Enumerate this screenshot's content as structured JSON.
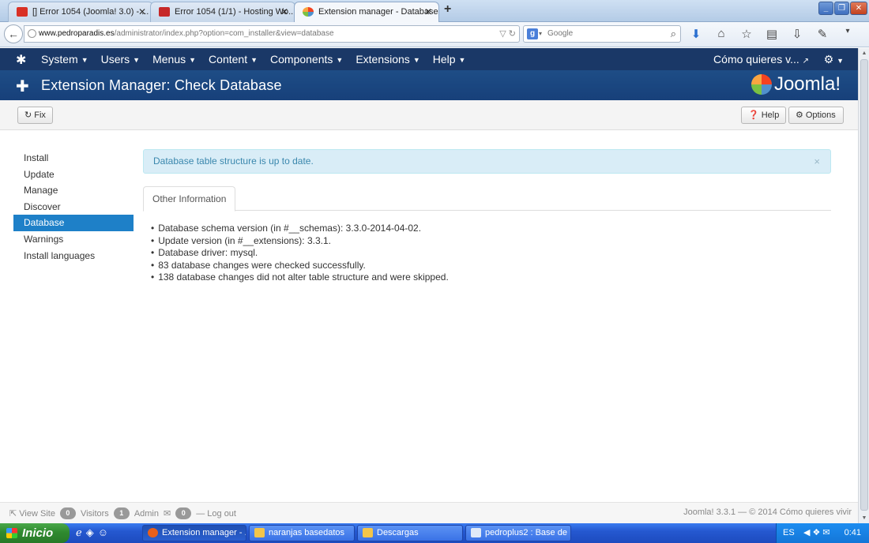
{
  "browser": {
    "tabs": [
      {
        "title": "[] Error 1054 (Joomla! 3.0) - ...",
        "favicon_color": "#d93025",
        "active": false
      },
      {
        "title": "Error 1054 (1/1) - Hosting Wo...",
        "favicon_color": "#c62828",
        "active": false
      },
      {
        "title": "Extension manager - Database",
        "favicon_color": "#f44321",
        "active": true
      }
    ],
    "new_tab_symbol": "+",
    "close_symbol": "✕",
    "url_host": "www.pedroparadis.es",
    "url_path": "/administrator/index.php?option=com_installer&view=database",
    "search_placeholder": "Google",
    "search_engine_letter": "g"
  },
  "joomla_nav": {
    "menus": [
      "System",
      "Users",
      "Menus",
      "Content",
      "Components",
      "Extensions",
      "Help"
    ],
    "site_link": "Cómo quieres v..."
  },
  "subhead": {
    "title": "Extension Manager: Check Database",
    "brand": "Joomla!"
  },
  "toolbar": {
    "fix_label": "Fix",
    "help_label": "Help",
    "options_label": "Options"
  },
  "sidebar": {
    "items": [
      "Install",
      "Update",
      "Manage",
      "Discover",
      "Database",
      "Warnings",
      "Install languages"
    ],
    "active_index": 4
  },
  "alert": {
    "message": "Database table structure is up to date.",
    "close_symbol": "×"
  },
  "tab_label": "Other Information",
  "info": [
    "Database schema version (in #__schemas): 3.3.0-2014-04-02.",
    "Update version (in #__extensions): 3.3.1.",
    "Database driver: mysql.",
    "83 database changes were checked successfully.",
    "138 database changes did not alter table structure and were skipped."
  ],
  "status": {
    "view_site": "View Site",
    "visitors_count": "0",
    "visitors_label": "Visitors",
    "admin_count": "1",
    "admin_label": "Admin",
    "messages_count": "0",
    "logout": "Log out",
    "footer": "Joomla! 3.3.1 — © 2014 Cómo quieres vivir"
  },
  "taskbar": {
    "start_label": "Inicio",
    "tasks": [
      {
        "label": "Extension manager - ...",
        "icon_color": "#e8601c",
        "active": true
      },
      {
        "label": "naranjas basedatos",
        "icon_color": "#f3c54a",
        "active": false
      },
      {
        "label": "Descargas",
        "icon_color": "#f3c54a",
        "active": false
      },
      {
        "label": "pedroplus2 : Base de ...",
        "icon_color": "#dfe9f8",
        "active": false
      }
    ],
    "lang": "ES",
    "clock": "0:41"
  },
  "colors": {
    "joomla_nav_bg": "#1a3867",
    "subhead_bg": "#1e4d86",
    "sidebar_active": "#1e80c8",
    "alert_bg": "#d9edf7",
    "alert_text": "#3a87ad"
  }
}
